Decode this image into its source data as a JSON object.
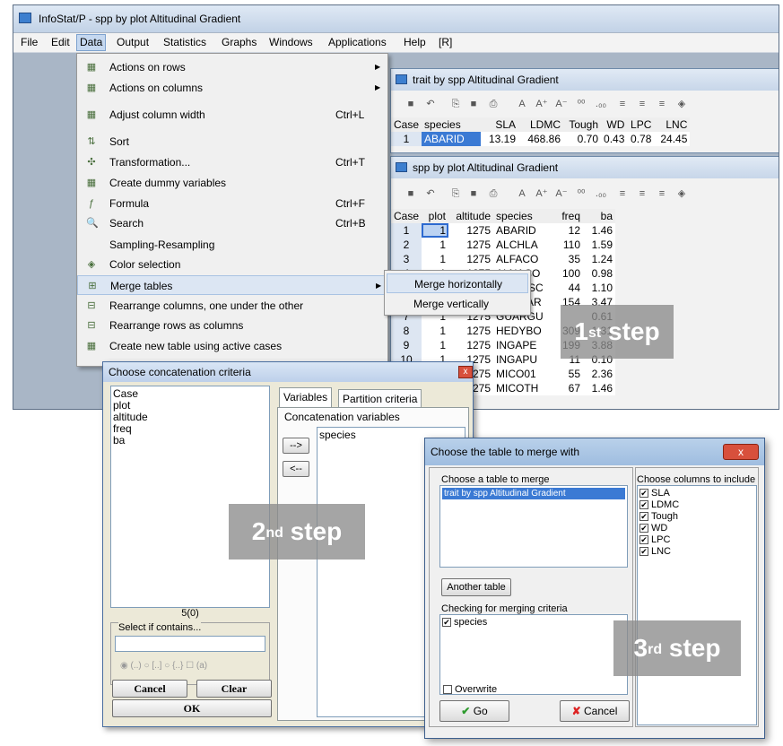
{
  "app": {
    "title": "InfoStat/P - spp by plot  Altitudinal Gradient"
  },
  "menubar": {
    "file": "File",
    "edit": "Edit",
    "data": "Data",
    "output": "Output",
    "statistics": "Statistics",
    "graphs": "Graphs",
    "windows": "Windows",
    "applications": "Applications",
    "help": "Help",
    "r": "[R]"
  },
  "data_menu": [
    {
      "label": "Actions on rows",
      "shortcut": "",
      "arrow": "▶",
      "icon": "▦"
    },
    {
      "label": "Actions on columns",
      "shortcut": "",
      "arrow": "▶",
      "icon": "▦"
    },
    {
      "label": "Adjust column width",
      "shortcut": "Ctrl+L",
      "arrow": "",
      "icon": "▦"
    },
    {
      "label": "Sort",
      "shortcut": "",
      "arrow": "",
      "icon": "⇅"
    },
    {
      "label": "Transformation...",
      "shortcut": "Ctrl+T",
      "arrow": "",
      "icon": "✣"
    },
    {
      "label": "Create dummy variables",
      "shortcut": "",
      "arrow": "",
      "icon": "▦"
    },
    {
      "label": "Formula",
      "shortcut": "Ctrl+F",
      "arrow": "",
      "icon": "ƒ"
    },
    {
      "label": "Search",
      "shortcut": "Ctrl+B",
      "arrow": "",
      "icon": "🔍"
    },
    {
      "label": "Sampling-Resampling",
      "shortcut": "",
      "arrow": "",
      "icon": ""
    },
    {
      "label": "Color selection",
      "shortcut": "",
      "arrow": "",
      "icon": "◈"
    },
    {
      "label": "Merge tables",
      "shortcut": "",
      "arrow": "▶",
      "icon": "⊞"
    },
    {
      "label": "Rearrange columns, one under the other",
      "shortcut": "",
      "arrow": "",
      "icon": "⊟"
    },
    {
      "label": "Rearrange rows as columns",
      "shortcut": "",
      "arrow": "",
      "icon": "⊟"
    },
    {
      "label": "Create new table using active cases",
      "shortcut": "",
      "arrow": "",
      "icon": "▦"
    }
  ],
  "submenu": {
    "horizontal": "Merge horizontally",
    "vertical": "Merge vertically"
  },
  "trait_window": {
    "title": "trait by spp  Altitudinal Gradient",
    "headers": [
      "Case",
      "species",
      "SLA",
      "LDMC",
      "Tough",
      "WD",
      "LPC",
      "LNC"
    ],
    "rows": [
      [
        "1",
        "ABARID",
        "13.19",
        "468.86",
        "0.70",
        "0.43",
        "0.78",
        "24.45"
      ]
    ]
  },
  "spp_window": {
    "title": "spp by plot  Altitudinal Gradient",
    "headers": [
      "Case",
      "plot",
      "altitude",
      "species",
      "freq",
      "ba"
    ],
    "rows": [
      [
        "1",
        "1",
        "1275",
        "ABARID",
        "12",
        "1.46"
      ],
      [
        "2",
        "1",
        "1275",
        "ALCHLA",
        "110",
        "1.59"
      ],
      [
        "3",
        "1",
        "1275",
        "ALFACO",
        "35",
        "1.24"
      ],
      [
        "4",
        "1",
        "1275",
        "ALNACO",
        "100",
        "0.98"
      ],
      [
        "5",
        "1",
        "1275",
        "ARDITSC",
        "44",
        "1.10"
      ],
      [
        "6",
        "1",
        "1275",
        "CEDDAR",
        "154",
        "3.47"
      ],
      [
        "7",
        "1",
        "1275",
        "GUARGU",
        "",
        "0.61"
      ],
      [
        "8",
        "1",
        "1275",
        "HEDYBO",
        "309",
        "1.31"
      ],
      [
        "9",
        "1",
        "1275",
        "INGAPE",
        "199",
        "3.88"
      ],
      [
        "10",
        "1",
        "1275",
        "INGAPU",
        "11",
        "0.10"
      ],
      [
        "11",
        "1",
        "1275",
        "MICO01",
        "55",
        "2.36"
      ],
      [
        "12",
        "1",
        "1275",
        "MICOTH",
        "67",
        "1.46"
      ]
    ]
  },
  "concat_dialog": {
    "title": "Choose concatenation criteria",
    "variables": [
      "Case",
      "plot",
      "altitude",
      "freq",
      "ba"
    ],
    "count": "5(0)",
    "select_label": "Select if contains...",
    "select_value": "",
    "radio_labels": [
      "(..)",
      "[..]",
      "{..}",
      "(a)"
    ],
    "cancel": "Cancel",
    "clear": "Clear",
    "ok": "OK",
    "tab_variables": "Variables",
    "tab_partition": "Partition criteria",
    "concat_label": "Concatenation variables",
    "concat_vars": [
      "species"
    ],
    "add_btn": "-->",
    "remove_btn": "<--"
  },
  "merge_dialog": {
    "title": "Choose the table to merge with",
    "table_label": "Choose a table to merge",
    "tables": [
      "trait by spp Altitudinal Gradient"
    ],
    "columns_label": "Choose columns to include",
    "columns": [
      "SLA",
      "LDMC",
      "Tough",
      "WD",
      "LPC",
      "LNC"
    ],
    "another": "Another table",
    "criteria_label": "Checking for merging criteria",
    "criteria": [
      "species"
    ],
    "overwrite": "Overwrite",
    "go": "Go",
    "cancel": "Cancel"
  },
  "steps": {
    "s1_num": "1",
    "s1_sup": "st",
    "s1_word": "step",
    "s2_num": "2",
    "s2_sup": "nd",
    "s2_word": "step",
    "s3_num": "3",
    "s3_sup": "rd",
    "s3_word": "step"
  },
  "colors": {
    "selection": "#3b7ad4",
    "highlight": "#dce6f3",
    "step_overlay": "#8c8c8c"
  }
}
